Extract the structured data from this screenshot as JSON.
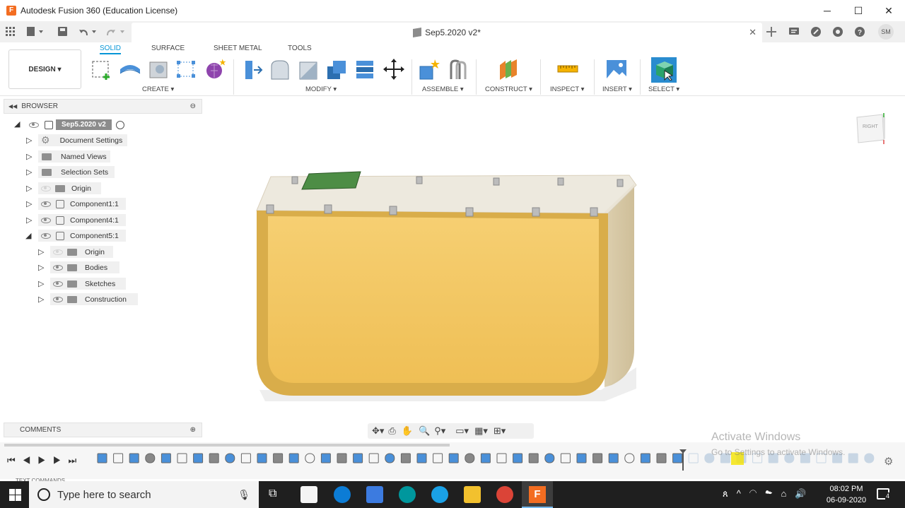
{
  "window": {
    "title": "Autodesk Fusion 360 (Education License)",
    "app_icon": "F"
  },
  "document": {
    "tab_title": "Sep5.2020 v2*"
  },
  "user": {
    "initials": "SM"
  },
  "ribbon": {
    "workspace": "DESIGN",
    "tabs": [
      "SOLID",
      "SURFACE",
      "SHEET METAL",
      "TOOLS"
    ],
    "active_tab": "SOLID",
    "groups": [
      "CREATE",
      "MODIFY",
      "ASSEMBLE",
      "CONSTRUCT",
      "INSPECT",
      "INSERT",
      "SELECT"
    ]
  },
  "browser": {
    "title": "BROWSER",
    "root": "Sep5.2020 v2",
    "items": [
      "Document Settings",
      "Named Views",
      "Selection Sets",
      "Origin",
      "Component1:1",
      "Component4:1",
      "Component5:1"
    ],
    "children": [
      "Origin",
      "Bodies",
      "Sketches",
      "Construction"
    ]
  },
  "comments": {
    "title": "COMMENTS"
  },
  "viewcube": {
    "face": "RIGHT"
  },
  "watermark": {
    "line1": "Activate Windows",
    "line2": "Go to Settings to activate Windows."
  },
  "taskbar": {
    "search_placeholder": "Type here to search",
    "time": "08:02 PM",
    "date": "06-09-2020",
    "notification_count": "4"
  },
  "colors": {
    "accent": "#0696d7",
    "body": "#f3c65c",
    "fusion_orange": "#f36d21"
  },
  "icons": [
    "grid-icon",
    "file-icon",
    "save-icon",
    "undo-icon",
    "redo-icon",
    "plus-icon",
    "notification-icon",
    "help-icon"
  ]
}
